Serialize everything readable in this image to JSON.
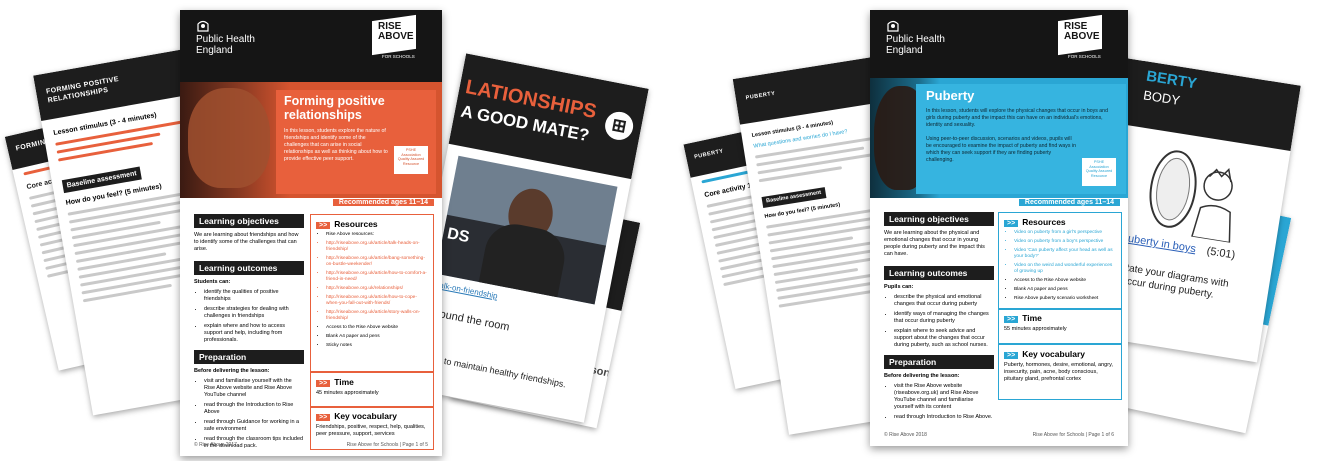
{
  "colors": {
    "orange": "#e8603c",
    "blue": "#2aa6d4",
    "dark": "#1d1d1d"
  },
  "left": {
    "back_sheet_title": "FORMING POSITIVE RELATIONSHIPS",
    "back_sheet_header": "FORMING POSITIVE R",
    "lesson_stimulus": "Lesson stimulus (3 - 4 minutes)",
    "baseline": "Baseline assessment",
    "how_do_you_feel": "How do you feel? (5 minutes)",
    "core_activity": "Core activity 1",
    "slide_title": "LATIONSHIPS",
    "slide_subtitle": "A GOOD MATE?",
    "slide_video_text": "DS",
    "slide_caption": "Talk-on-friendship",
    "slide_room": "around the room",
    "slide_ways": "ways to maintain healthy friendships.",
    "slide_edge_text": "esson.",
    "phe": [
      "Public Health",
      "England"
    ],
    "logo": [
      "RISE",
      "ABOVE",
      "FOR SCHOOLS"
    ],
    "hero_title": "Forming positive relationships",
    "hero_text": "In this lesson, students explore the nature of friendships and identify some of the challenges that can arise in social relationships as well as thinking about how to provide effective peer support.",
    "badge": "PSHE Association Quality Assured Resource",
    "age": "Recommended ages 11–14",
    "objectives_head": "Learning objectives",
    "objectives_text": "We are learning about friendships and how to identify some of the challenges that can arise.",
    "outcomes_head": "Learning outcomes",
    "outcomes_lead": "Students can:",
    "outcomes": [
      "identify the qualities of positive friendships",
      "describe strategies for dealing with challenges in friendships",
      "explain where and how to access support and help, including from professionals."
    ],
    "prep_head": "Preparation",
    "prep_lead": "Before delivering the lesson:",
    "prep": [
      "visit and familiarise yourself with the Rise Above website and Rise Above YouTube channel",
      "read through the Introduction to Rise Above",
      "read through Guidance for working in a safe environment",
      "read through the classroom tips included in the download pack."
    ],
    "resources_head": "Resources",
    "resources": [
      "Rise Above resources:",
      "http://riseabove.org.uk/article/talk-heads-on-friendship/",
      "http://riseabove.org.uk/article/bang-something-on-bustle-weekender/",
      "http://riseabove.org.uk/article/how-to-comfort-a-friend-in-need/",
      "http://riseabove.org.uk/relationships/",
      "http://riseabove.org.uk/article/how-to-cope-when-you-fall-out-with-friends/",
      "http://riseabove.org.uk/article/story-walls-on-friendship/",
      "Access to the Rise Above website",
      "Blank A4 paper and pens",
      "Sticky notes"
    ],
    "time_head": "Time",
    "time_text": "45 minutes approximately",
    "vocab_head": "Key vocabulary",
    "vocab_text": "Friendships, positive, respect, help, qualities, peer pressure, support, services",
    "footer_left": "© Rise Above 2017",
    "footer_right": "Rise Above for Schools | Page 1 of 5"
  },
  "right": {
    "back_header": "PUBERTY",
    "back_header2": "PUBERTY",
    "lesson_stimulus": "Lesson stimulus (3 - 4 minutes)",
    "what_question": "What questions and worries do I have?",
    "baseline": "Baseline assessment",
    "how_do_you_feel": "How do you feel? (5 minutes)",
    "core_activity": "Core activity 1",
    "slide_title": "BERTY",
    "slide_subtitle": "BODY",
    "slide_link": "Puberty in boys",
    "slide_duration": "(5:01)",
    "slide_text1": "annotate your diagrams with",
    "slide_text2": "that occur during puberty.",
    "phe": [
      "Public Health",
      "England"
    ],
    "logo": [
      "RISE",
      "ABOVE",
      "FOR SCHOOLS"
    ],
    "hero_title": "Puberty",
    "hero_text1": "In this lesson, students will explore the physical changes that occur in boys and girls during puberty and the impact this can have on an individual's emotions, identity and sexuality.",
    "hero_text2": "Using peer-to-peer discussion, scenarios and videos, pupils will be encouraged to examine the impact of puberty and find ways in which they can seek support if they are finding puberty challenging.",
    "badge": "PSHE Association Quality Assured Resource",
    "age": "Recommended ages 11–14",
    "objectives_head": "Learning objectives",
    "objectives_text": "We are learning about the physical and emotional changes that occur in young people during puberty and the impact this can have.",
    "outcomes_head": "Learning outcomes",
    "outcomes_lead": "Pupils can:",
    "outcomes": [
      "describe the physical and emotional changes that occur during puberty",
      "identify ways of managing the changes that occur during puberty",
      "explain where to seek advice and support about the changes that occur during puberty, such as school nurses."
    ],
    "prep_head": "Preparation",
    "prep_lead": "Before delivering the lesson:",
    "prep": [
      "visit the Rise Above website (riseabove.org.uk) and Rise Above YouTube channel and familiarise yourself with its content",
      "read through Introduction to Rise Above."
    ],
    "resources_head": "Resources",
    "resources": [
      "Video on puberty from a girl's perspective",
      "Video on puberty from a boy's perspective",
      "Video 'Can puberty affect your head as well as your body?'",
      "Video on the weird and wonderful experiences of growing up",
      "Access to the Rise Above website",
      "Blank A4 paper and pens",
      "Rise Above puberty scenario worksheet"
    ],
    "time_head": "Time",
    "time_text": "55 minutes approximately",
    "vocab_head": "Key vocabulary",
    "vocab_text": "Puberty, hormones, desire, emotional, angry, insecurity, pain, acne, body conscious, pituitary gland, prefrontal cortex",
    "footer_left": "© Rise Above 2018",
    "footer_right": "Rise Above for Schools | Page 1 of 6"
  }
}
